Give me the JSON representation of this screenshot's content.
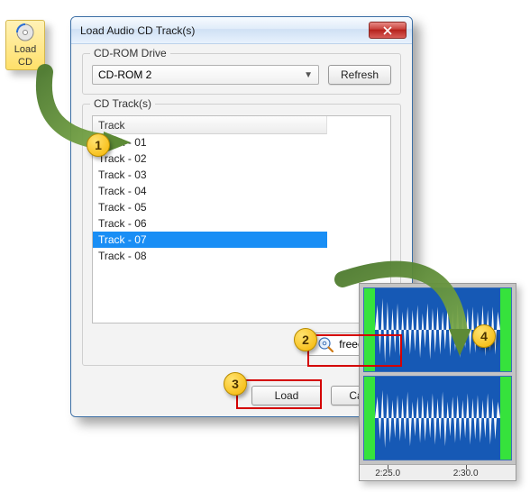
{
  "sidebar": {
    "load_cd_line1": "Load",
    "load_cd_line2": "CD"
  },
  "dialog": {
    "title": "Load Audio CD Track(s)",
    "close_icon": "close",
    "drive_group_label": "CD-ROM Drive",
    "drive_selected": "CD-ROM 2",
    "refresh_label": "Refresh",
    "tracks_group_label": "CD Track(s)",
    "list_header": "Track",
    "tracks": [
      {
        "label": "Track - 01",
        "selected": false
      },
      {
        "label": "Track - 02",
        "selected": false
      },
      {
        "label": "Track - 03",
        "selected": false
      },
      {
        "label": "Track - 04",
        "selected": false
      },
      {
        "label": "Track - 05",
        "selected": false
      },
      {
        "label": "Track - 06",
        "selected": false
      },
      {
        "label": "Track - 07",
        "selected": true
      },
      {
        "label": "Track - 08",
        "selected": false
      }
    ],
    "freecddb_label": "freecddb",
    "load_label": "Load",
    "cancel_label": "Cancel"
  },
  "markers": {
    "m1": "1",
    "m2": "2",
    "m3": "3",
    "m4": "4"
  },
  "waveform": {
    "time1": "2:25.0",
    "time2": "2:30.0"
  }
}
